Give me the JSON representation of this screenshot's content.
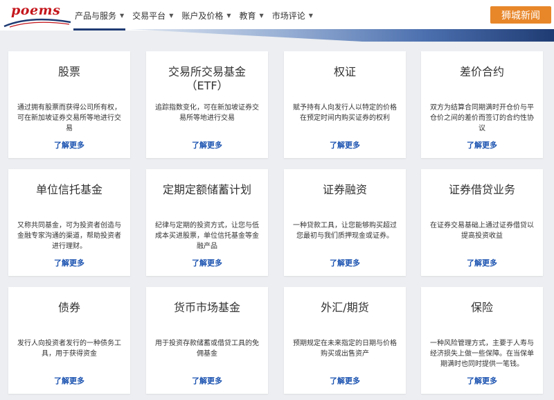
{
  "header": {
    "logo_text": "poems",
    "nav": [
      {
        "label": "产品与服务",
        "active": true
      },
      {
        "label": "交易平台",
        "active": false
      },
      {
        "label": "账户及价格",
        "active": false
      },
      {
        "label": "教育",
        "active": false
      },
      {
        "label": "市场评论",
        "active": false
      }
    ],
    "watermark": "狮城新闻"
  },
  "cards": [
    {
      "title": "股票",
      "desc": "通过拥有股票而获得公司所有权，可在新加坡证券交易所等地进行交易",
      "link": "了解更多"
    },
    {
      "title": "交易所交易基金（ETF）",
      "desc": "追踪指数变化，可在新加坡证券交易所等地进行交易",
      "link": "了解更多"
    },
    {
      "title": "权证",
      "desc": "赋予持有人向发行人以特定的价格在预定时间内购买证券的权利",
      "link": "了解更多"
    },
    {
      "title": "差价合约",
      "desc": "双方为结算合同期满时开仓价与平仓价之间的差价而签订的合约性协议",
      "link": "了解更多"
    },
    {
      "title": "单位信托基金",
      "desc": "又称共同基金，可为投资者创造与金融专家沟通的渠道，帮助投资者进行理财。",
      "link": "了解更多"
    },
    {
      "title": "定期定额储蓄计划",
      "desc": "纪律与定期的投资方式，让您与低成本买进股票，单位信托基金等金融产品",
      "link": "了解更多"
    },
    {
      "title": "证券融资",
      "desc": "一种贷款工具，让您能够购买超过您最初与我们质押现金或证券。",
      "link": "了解更多"
    },
    {
      "title": "证券借贷业务",
      "desc": "在证券交易基础上通过证券借贷以提高投资收益",
      "link": "了解更多"
    },
    {
      "title": "债券",
      "desc": "发行人向投资者发行的一种债务工具，用于获得资金",
      "link": "了解更多"
    },
    {
      "title": "货币市场基金",
      "desc": "用于投资存款储蓄或借贷工具的免佣基金",
      "link": "了解更多"
    },
    {
      "title": "外汇/期货",
      "desc": "预期规定在未来指定的日期与价格购买或出售资产",
      "link": "了解更多"
    },
    {
      "title": "保险",
      "desc": "一种风险管理方式，主要于人寿与经济损失上做一些保障。在当保单期满时也同时提供一笔钱。",
      "link": "了解更多"
    }
  ]
}
